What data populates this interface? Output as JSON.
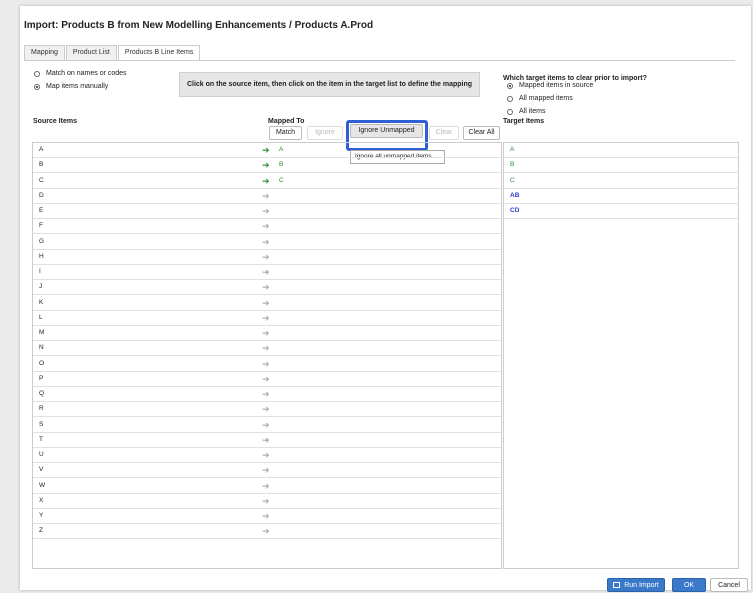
{
  "dialog": {
    "title": "Import: Products B from New Modelling Enhancements / Products A.Prod",
    "tabs": [
      {
        "label": "Mapping",
        "active": false
      },
      {
        "label": "Product List",
        "active": false
      },
      {
        "label": "Products B Line Items",
        "active": true
      }
    ]
  },
  "match_options": [
    {
      "label": "Match on names or codes",
      "checked": false
    },
    {
      "label": "Map items manually",
      "checked": true
    }
  ],
  "instruction": "Click on the source item, then click on the item in the target list to define the mapping",
  "clear_section": {
    "title": "Which target items to clear prior to import?",
    "options": [
      {
        "label": "Mapped items in source",
        "checked": true
      },
      {
        "label": "All mapped items",
        "checked": false
      },
      {
        "label": "All items",
        "checked": false
      }
    ]
  },
  "headers": {
    "source": "Source Items",
    "mapped_to": "Mapped To",
    "target": "Target Items"
  },
  "toolbar": {
    "match": "Match",
    "ignore": "Ignore",
    "ignore_unmapped": "Ignore Unmapped",
    "clear": "Clear",
    "clear_all": "Clear All"
  },
  "tooltip": "Ignore all unmapped items",
  "source_rows": [
    {
      "source": "A",
      "mapped": "A"
    },
    {
      "source": "B",
      "mapped": "B"
    },
    {
      "source": "C",
      "mapped": "C"
    },
    {
      "source": "D",
      "mapped": ""
    },
    {
      "source": "E",
      "mapped": ""
    },
    {
      "source": "F",
      "mapped": ""
    },
    {
      "source": "G",
      "mapped": ""
    },
    {
      "source": "H",
      "mapped": ""
    },
    {
      "source": "I",
      "mapped": ""
    },
    {
      "source": "J",
      "mapped": ""
    },
    {
      "source": "K",
      "mapped": ""
    },
    {
      "source": "L",
      "mapped": ""
    },
    {
      "source": "M",
      "mapped": ""
    },
    {
      "source": "N",
      "mapped": ""
    },
    {
      "source": "O",
      "mapped": ""
    },
    {
      "source": "P",
      "mapped": ""
    },
    {
      "source": "Q",
      "mapped": ""
    },
    {
      "source": "R",
      "mapped": ""
    },
    {
      "source": "S",
      "mapped": ""
    },
    {
      "source": "T",
      "mapped": ""
    },
    {
      "source": "U",
      "mapped": ""
    },
    {
      "source": "V",
      "mapped": ""
    },
    {
      "source": "W",
      "mapped": ""
    },
    {
      "source": "X",
      "mapped": ""
    },
    {
      "source": "Y",
      "mapped": ""
    },
    {
      "source": "Z",
      "mapped": ""
    }
  ],
  "target_rows": [
    {
      "label": "A",
      "status": "mapped"
    },
    {
      "label": "B",
      "status": "mapped"
    },
    {
      "label": "C",
      "status": "mapped"
    },
    {
      "label": "AB",
      "status": "new"
    },
    {
      "label": "CD",
      "status": "new"
    }
  ],
  "footer": {
    "run_import": "Run Import",
    "ok": "OK",
    "cancel": "Cancel"
  },
  "colors": {
    "accent": "#3a78c9",
    "highlight": "#2f5fd6",
    "mapped_green": "#2e8b2e",
    "target_blue": "#2a3fd1"
  }
}
